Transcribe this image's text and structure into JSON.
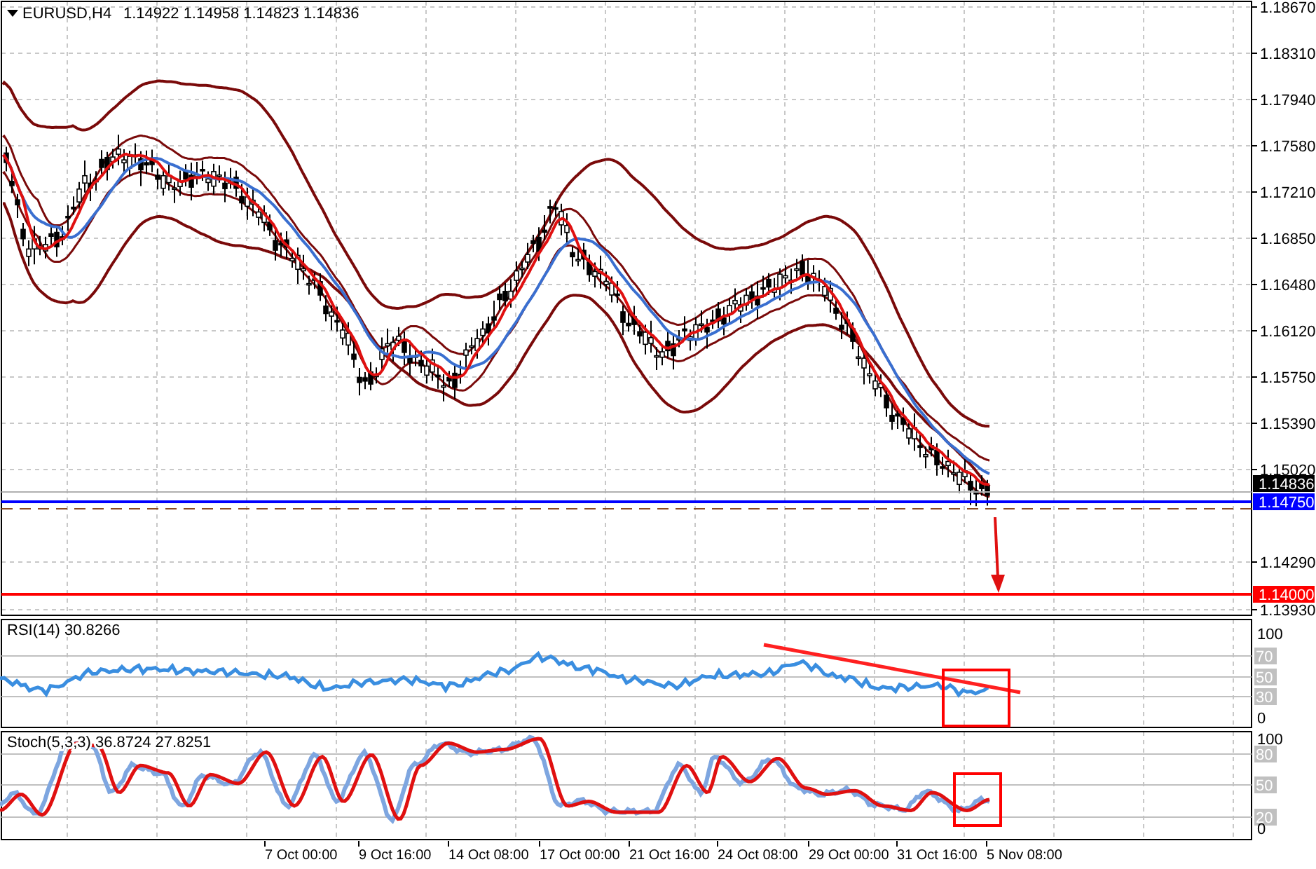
{
  "price_chart": {
    "header": {
      "symbol": "EURUSD,H4",
      "quotes": [
        "1.14922",
        "1.14958",
        "1.14823",
        "1.14836"
      ]
    },
    "price_axis": [
      "1.18670",
      "1.18310",
      "1.17940",
      "1.17580",
      "1.17210",
      "1.16850",
      "1.16480",
      "1.16120",
      "1.15750",
      "1.15390",
      "1.15020",
      "1.14290",
      "1.13930"
    ],
    "price_markers": [
      {
        "kind": "bid",
        "label": "1.14836"
      },
      {
        "kind": "level",
        "label": "1.14750",
        "color": "#0000ff"
      },
      {
        "kind": "level",
        "label": "1.14000",
        "color": "#ff0000"
      }
    ]
  },
  "rsi_panel": {
    "title": "RSI(14) 30.8266",
    "axis": [
      {
        "label": "100",
        "kind": "plain"
      },
      {
        "label": "70",
        "kind": "level"
      },
      {
        "label": "50",
        "kind": "level"
      },
      {
        "label": "30",
        "kind": "level"
      },
      {
        "label": "0",
        "kind": "plain"
      }
    ]
  },
  "stochastic_panel": {
    "title": "Stoch(5,3,3) 36.8724 27.8251",
    "axis": [
      {
        "label": "100",
        "kind": "plain"
      },
      {
        "label": "80",
        "kind": "level"
      },
      {
        "label": "50",
        "kind": "level"
      },
      {
        "label": "20",
        "kind": "level"
      },
      {
        "label": "0",
        "kind": "plain"
      }
    ]
  },
  "time_axis": [
    "7 Oct 00:00",
    "9 Oct 16:00",
    "14 Oct 08:00",
    "17 Oct 00:00",
    "21 Oct 16:00",
    "24 Oct 08:00",
    "29 Oct 00:00",
    "31 Oct 16:00",
    "5 Nov 08:00"
  ]
}
